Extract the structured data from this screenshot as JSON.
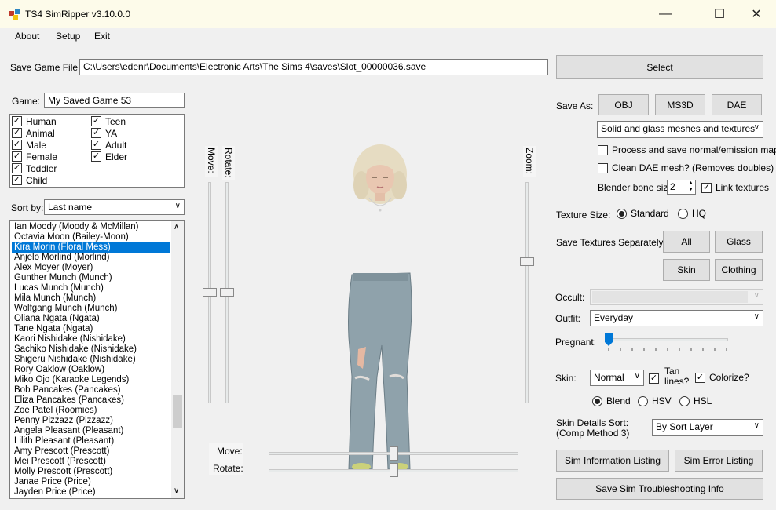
{
  "window": {
    "title": "TS4 SimRipper v3.10.0.0"
  },
  "menu": [
    "About",
    "Setup",
    "Exit"
  ],
  "save_file": {
    "label": "Save Game File:",
    "value": "C:\\Users\\edenr\\Documents\\Electronic Arts\\The Sims 4\\saves\\Slot_00000036.save",
    "select_button": "Select"
  },
  "game": {
    "label": "Game:",
    "value": "My Saved Game 53"
  },
  "filters": {
    "col1": [
      {
        "label": "Human",
        "checked": true
      },
      {
        "label": "Animal",
        "checked": true
      },
      {
        "label": "Male",
        "checked": true
      },
      {
        "label": "Female",
        "checked": true
      },
      {
        "label": "Toddler",
        "checked": true
      },
      {
        "label": "Child",
        "checked": true
      }
    ],
    "col2": [
      {
        "label": "Teen",
        "checked": true
      },
      {
        "label": "YA",
        "checked": true
      },
      {
        "label": "Adult",
        "checked": true
      },
      {
        "label": "Elder",
        "checked": true
      }
    ]
  },
  "sort": {
    "label": "Sort by:",
    "value": "Last name"
  },
  "sims": [
    "Ian Moody (Moody & McMillan)",
    "Octavia Moon (Bailey-Moon)",
    "Kira Morin (Floral Mess)",
    "Anjelo Morlind (Morlind)",
    "Alex Moyer (Moyer)",
    "Gunther Munch (Munch)",
    "Lucas Munch (Munch)",
    "Mila Munch (Munch)",
    "Wolfgang Munch (Munch)",
    "Oliana Ngata (Ngata)",
    "Tane Ngata (Ngata)",
    "Kaori Nishidake (Nishidake)",
    "Sachiko Nishidake (Nishidake)",
    "Shigeru Nishidake (Nishidake)",
    "Rory Oaklow (Oaklow)",
    "Miko Ojo (Karaoke Legends)",
    "Bob Pancakes (Pancakes)",
    "Eliza Pancakes (Pancakes)",
    "Zoe Patel (Roomies)",
    "Penny Pizzazz (Pizzazz)",
    "Angela Pleasant (Pleasant)",
    "Lilith Pleasant (Pleasant)",
    "Amy Prescott (Prescott)",
    "Mei Prescott (Prescott)",
    "Molly Prescott (Prescott)",
    "Janae Price (Price)",
    "Jayden Price (Price)"
  ],
  "selected_sim_index": 2,
  "viewer": {
    "move_label": "Move:",
    "rotate_label": "Rotate:",
    "zoom_label": "Zoom:"
  },
  "save_as": {
    "label": "Save As:",
    "buttons": [
      "OBJ",
      "MS3D",
      "DAE"
    ],
    "mesh_option": "Solid and glass meshes and textures"
  },
  "options": {
    "normal_maps": {
      "label": "Process and save normal/emission maps",
      "checked": false
    },
    "clean_dae": {
      "label": "Clean DAE mesh? (Removes doubles)",
      "checked": false
    },
    "bone_size_label": "Blender bone size",
    "bone_size_value": "2",
    "link_textures": {
      "label": "Link textures",
      "checked": true
    }
  },
  "texture_size": {
    "label": "Texture Size:",
    "standard": "Standard",
    "hq": "HQ",
    "selected": "standard"
  },
  "save_textures": {
    "label": "Save Textures Separately:",
    "buttons": [
      "All",
      "Glass",
      "Skin",
      "Clothing"
    ]
  },
  "occult": {
    "label": "Occult:",
    "value": ""
  },
  "outfit": {
    "label": "Outfit:",
    "value": "Everyday"
  },
  "pregnant": {
    "label": "Pregnant:",
    "value": 0
  },
  "skin": {
    "label": "Skin:",
    "value": "Normal",
    "tan_lines": {
      "label": "Tan lines?",
      "checked": true
    },
    "colorize": {
      "label": "Colorize?",
      "checked": true
    },
    "modes": [
      "Blend",
      "HSV",
      "HSL"
    ],
    "selected_mode": "Blend"
  },
  "skin_details": {
    "label1": "Skin Details Sort:",
    "label2": "(Comp Method 3)",
    "value": "By Sort Layer"
  },
  "bottom_buttons": {
    "info": "Sim Information Listing",
    "errors": "Sim Error Listing",
    "troubleshoot": "Save Sim Troubleshooting Info"
  }
}
